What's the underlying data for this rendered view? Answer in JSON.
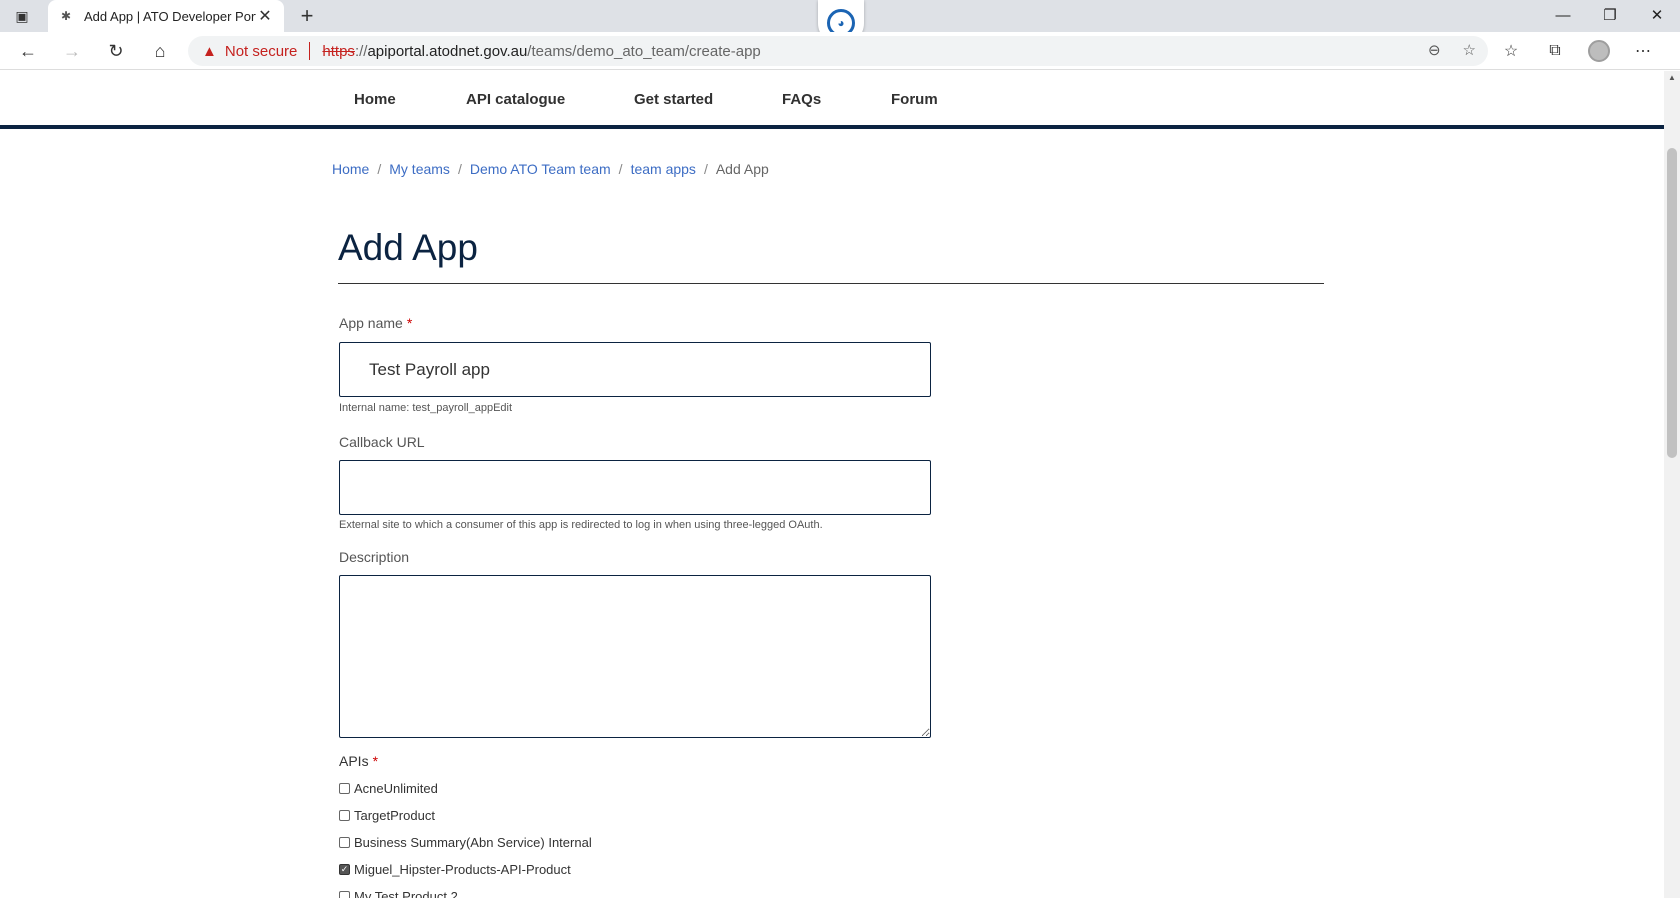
{
  "browser": {
    "tab_title": "Add App | ATO Developer Portal",
    "not_secure_label": "Not secure",
    "url_scheme": "https",
    "url_sep": "://",
    "url_host": "apiportal.atodnet.gov.au",
    "url_path": "/teams/demo_ato_team/create-app"
  },
  "site_nav": {
    "items": [
      "Home",
      "API catalogue",
      "Get started",
      "FAQs",
      "Forum"
    ]
  },
  "breadcrumb": {
    "items": [
      "Home",
      "My teams",
      "Demo ATO Team team",
      "team apps"
    ],
    "separator": "/",
    "current": "Add App"
  },
  "page": {
    "title": "Add App"
  },
  "form": {
    "app_name_label": "App name",
    "required_marker": "*",
    "app_name_value": "Test Payroll app",
    "app_name_help": "Internal name: test_payroll_appEdit",
    "callback_label": "Callback URL",
    "callback_value": "",
    "callback_help": "External site to which a consumer of this app is redirected to log in when using three-legged OAuth.",
    "description_label": "Description",
    "apis_label": "APIs",
    "apis": [
      {
        "label": "AcneUnlimited",
        "checked": false
      },
      {
        "label": "TargetProduct",
        "checked": false
      },
      {
        "label": "Business Summary(Abn Service) Internal",
        "checked": false
      },
      {
        "label": "Miguel_Hipster-Products-API-Product",
        "checked": true
      },
      {
        "label": "My Test Product 2",
        "checked": false
      }
    ]
  }
}
